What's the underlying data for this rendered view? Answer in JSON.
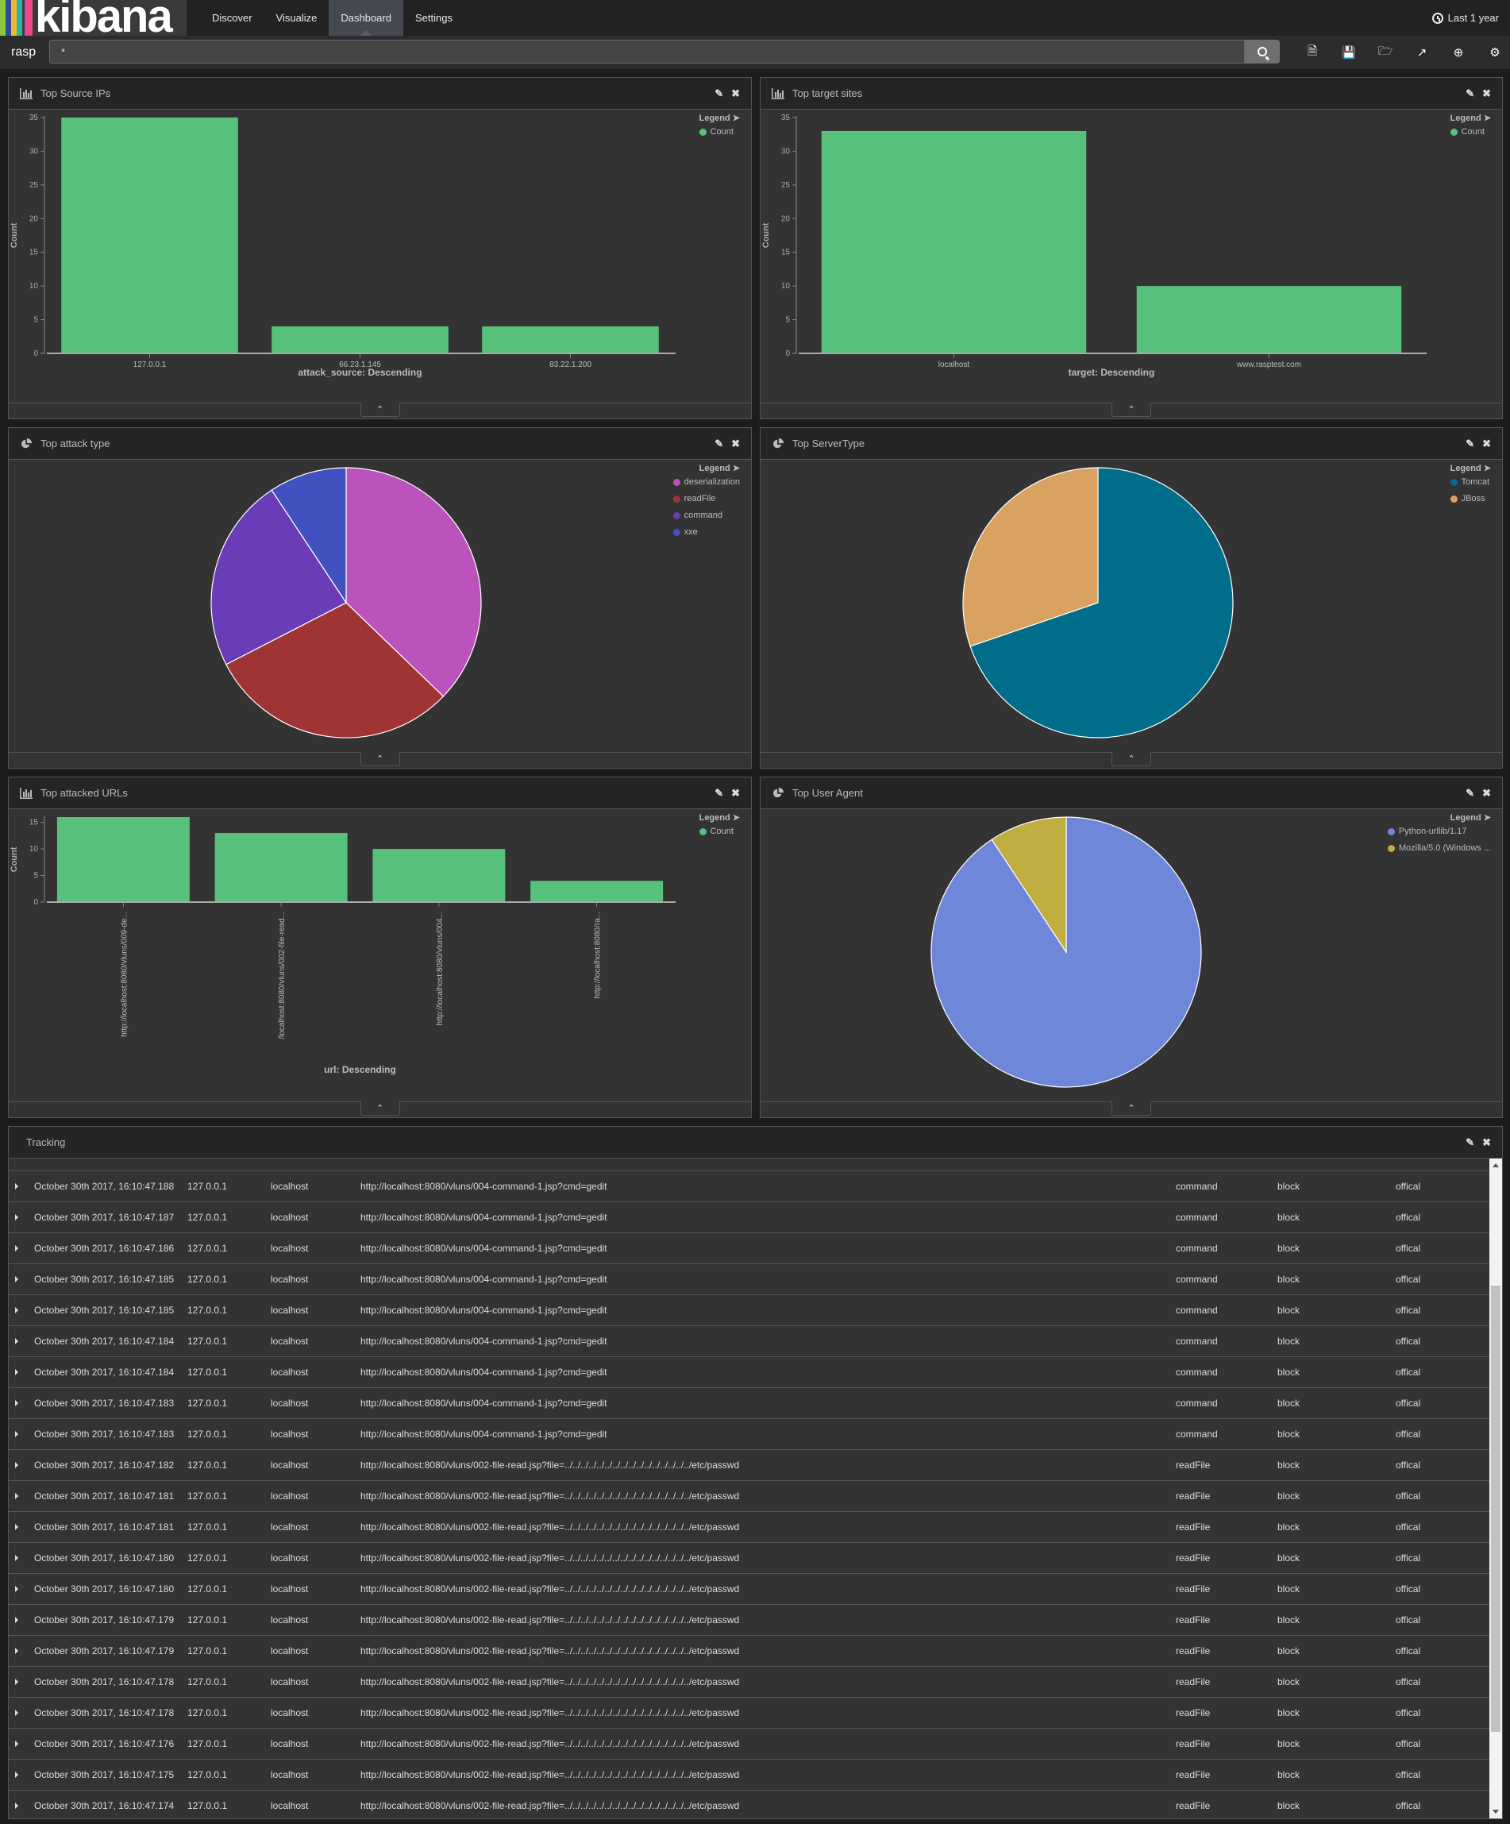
{
  "app": {
    "logo_text": "kibana",
    "logo_colors": [
      "#8cc63f",
      "#2b4b9b",
      "#f5b72d",
      "#1fb8a9",
      "#e8478b"
    ],
    "nav": [
      {
        "label": "Discover",
        "active": false
      },
      {
        "label": "Visualize",
        "active": false
      },
      {
        "label": "Dashboard",
        "active": true
      },
      {
        "label": "Settings",
        "active": false
      }
    ],
    "time_range": "Last 1 year"
  },
  "query": {
    "index": "rasp",
    "value": "*",
    "toolbar_icons": [
      "new-dashboard-icon",
      "save-icon",
      "open-folder-icon",
      "share-icon",
      "add-panel-icon",
      "gear-icon"
    ]
  },
  "panels": {
    "source_ips": {
      "title": "Top Source IPs",
      "legend_title": "Legend",
      "x_label": "attack_source: Descending",
      "y_label": "Count"
    },
    "target_sites": {
      "title": "Top target sites",
      "legend_title": "Legend",
      "x_label": "target: Descending",
      "y_label": "Count"
    },
    "attack_type": {
      "title": "Top attack type",
      "legend_title": "Legend"
    },
    "server_type": {
      "title": "Top ServerType",
      "legend_title": "Legend"
    },
    "attacked_urls": {
      "title": "Top attacked URLs",
      "legend_title": "Legend",
      "x_label": "url: Descending",
      "y_label": "Count"
    },
    "user_agent": {
      "title": "Top User Agent",
      "legend_title": "Legend"
    },
    "tracking": {
      "title": "Tracking"
    }
  },
  "chart_data": [
    {
      "id": "source_ips",
      "type": "bar",
      "title": "Top Source IPs",
      "categories": [
        "127.0.0.1",
        "66.23.1.145",
        "83.22.1.200"
      ],
      "values": [
        35,
        4,
        4
      ],
      "xlabel": "attack_source: Descending",
      "ylabel": "Count",
      "ylim": [
        0,
        35
      ],
      "yticks": [
        0,
        5,
        10,
        15,
        20,
        25,
        30,
        35
      ],
      "legend": [
        {
          "name": "Count",
          "color": "#57c17b"
        }
      ],
      "legend_position": "top-right",
      "grid": false
    },
    {
      "id": "target_sites",
      "type": "bar",
      "title": "Top target sites",
      "categories": [
        "localhost",
        "www.rasptest.com"
      ],
      "values": [
        33,
        10
      ],
      "xlabel": "target: Descending",
      "ylabel": "Count",
      "ylim": [
        0,
        35
      ],
      "yticks": [
        0,
        5,
        10,
        15,
        20,
        25,
        30,
        35
      ],
      "legend": [
        {
          "name": "Count",
          "color": "#57c17b"
        }
      ],
      "legend_position": "top-right",
      "grid": false
    },
    {
      "id": "attack_type",
      "type": "pie",
      "title": "Top attack type",
      "categories": [
        "deserialization",
        "readFile",
        "command",
        "xxe"
      ],
      "values": [
        16,
        13,
        10,
        4
      ],
      "colors": [
        "#ba53bb",
        "#a03434",
        "#6a3cb8",
        "#4151c0"
      ],
      "legend_position": "top-right"
    },
    {
      "id": "server_type",
      "type": "pie",
      "title": "Top ServerType",
      "categories": [
        "Tomcat",
        "JBoss"
      ],
      "values": [
        30,
        13
      ],
      "colors": [
        "#006e8a",
        "#d9a261"
      ],
      "legend_position": "top-right"
    },
    {
      "id": "attacked_urls",
      "type": "bar",
      "title": "Top attacked URLs",
      "categories": [
        "http://localhost:8080/vluns/009-de...",
        "/localhost:8080/vluns/002-file-read...",
        "http://localhost:8080/vluns/004...",
        "http://localhost:8080/ra..."
      ],
      "values": [
        16,
        13,
        10,
        4
      ],
      "xlabel": "url: Descending",
      "ylabel": "Count",
      "ylim": [
        0,
        16
      ],
      "yticks": [
        0,
        5,
        10,
        15
      ],
      "legend": [
        {
          "name": "Count",
          "color": "#57c17b"
        }
      ],
      "legend_position": "top-right",
      "grid": false
    },
    {
      "id": "user_agent",
      "type": "pie",
      "title": "Top User Agent",
      "categories": [
        "Python-urllib/1.17",
        "Mozilla/5.0 (Windows ..."
      ],
      "values": [
        39,
        4
      ],
      "colors": [
        "#6f87d8",
        "#c0ae41"
      ],
      "legend_position": "top-right"
    }
  ],
  "tracking": {
    "rows": [
      [
        "October 30th 2017, 16:10:47.188",
        "127.0.0.1",
        "localhost",
        "http://localhost:8080/vluns/004-command-1.jsp?cmd=gedit",
        "command",
        "block",
        "offical"
      ],
      [
        "October 30th 2017, 16:10:47.187",
        "127.0.0.1",
        "localhost",
        "http://localhost:8080/vluns/004-command-1.jsp?cmd=gedit",
        "command",
        "block",
        "offical"
      ],
      [
        "October 30th 2017, 16:10:47.186",
        "127.0.0.1",
        "localhost",
        "http://localhost:8080/vluns/004-command-1.jsp?cmd=gedit",
        "command",
        "block",
        "offical"
      ],
      [
        "October 30th 2017, 16:10:47.185",
        "127.0.0.1",
        "localhost",
        "http://localhost:8080/vluns/004-command-1.jsp?cmd=gedit",
        "command",
        "block",
        "offical"
      ],
      [
        "October 30th 2017, 16:10:47.185",
        "127.0.0.1",
        "localhost",
        "http://localhost:8080/vluns/004-command-1.jsp?cmd=gedit",
        "command",
        "block",
        "offical"
      ],
      [
        "October 30th 2017, 16:10:47.184",
        "127.0.0.1",
        "localhost",
        "http://localhost:8080/vluns/004-command-1.jsp?cmd=gedit",
        "command",
        "block",
        "offical"
      ],
      [
        "October 30th 2017, 16:10:47.184",
        "127.0.0.1",
        "localhost",
        "http://localhost:8080/vluns/004-command-1.jsp?cmd=gedit",
        "command",
        "block",
        "offical"
      ],
      [
        "October 30th 2017, 16:10:47.183",
        "127.0.0.1",
        "localhost",
        "http://localhost:8080/vluns/004-command-1.jsp?cmd=gedit",
        "command",
        "block",
        "offical"
      ],
      [
        "October 30th 2017, 16:10:47.183",
        "127.0.0.1",
        "localhost",
        "http://localhost:8080/vluns/004-command-1.jsp?cmd=gedit",
        "command",
        "block",
        "offical"
      ],
      [
        "October 30th 2017, 16:10:47.182",
        "127.0.0.1",
        "localhost",
        "http://localhost:8080/vluns/002-file-read.jsp?file=../../../../../../../../../../../../../../../../etc/passwd",
        "readFile",
        "block",
        "offical"
      ],
      [
        "October 30th 2017, 16:10:47.181",
        "127.0.0.1",
        "localhost",
        "http://localhost:8080/vluns/002-file-read.jsp?file=../../../../../../../../../../../../../../../../etc/passwd",
        "readFile",
        "block",
        "offical"
      ],
      [
        "October 30th 2017, 16:10:47.181",
        "127.0.0.1",
        "localhost",
        "http://localhost:8080/vluns/002-file-read.jsp?file=../../../../../../../../../../../../../../../../etc/passwd",
        "readFile",
        "block",
        "offical"
      ],
      [
        "October 30th 2017, 16:10:47.180",
        "127.0.0.1",
        "localhost",
        "http://localhost:8080/vluns/002-file-read.jsp?file=../../../../../../../../../../../../../../../../etc/passwd",
        "readFile",
        "block",
        "offical"
      ],
      [
        "October 30th 2017, 16:10:47.180",
        "127.0.0.1",
        "localhost",
        "http://localhost:8080/vluns/002-file-read.jsp?file=../../../../../../../../../../../../../../../../etc/passwd",
        "readFile",
        "block",
        "offical"
      ],
      [
        "October 30th 2017, 16:10:47.179",
        "127.0.0.1",
        "localhost",
        "http://localhost:8080/vluns/002-file-read.jsp?file=../../../../../../../../../../../../../../../../etc/passwd",
        "readFile",
        "block",
        "offical"
      ],
      [
        "October 30th 2017, 16:10:47.179",
        "127.0.0.1",
        "localhost",
        "http://localhost:8080/vluns/002-file-read.jsp?file=../../../../../../../../../../../../../../../../etc/passwd",
        "readFile",
        "block",
        "offical"
      ],
      [
        "October 30th 2017, 16:10:47.178",
        "127.0.0.1",
        "localhost",
        "http://localhost:8080/vluns/002-file-read.jsp?file=../../../../../../../../../../../../../../../../etc/passwd",
        "readFile",
        "block",
        "offical"
      ],
      [
        "October 30th 2017, 16:10:47.178",
        "127.0.0.1",
        "localhost",
        "http://localhost:8080/vluns/002-file-read.jsp?file=../../../../../../../../../../../../../../../../etc/passwd",
        "readFile",
        "block",
        "offical"
      ],
      [
        "October 30th 2017, 16:10:47.176",
        "127.0.0.1",
        "localhost",
        "http://localhost:8080/vluns/002-file-read.jsp?file=../../../../../../../../../../../../../../../../etc/passwd",
        "readFile",
        "block",
        "offical"
      ],
      [
        "October 30th 2017, 16:10:47.175",
        "127.0.0.1",
        "localhost",
        "http://localhost:8080/vluns/002-file-read.jsp?file=../../../../../../../../../../../../../../../../etc/passwd",
        "readFile",
        "block",
        "offical"
      ],
      [
        "October 30th 2017, 16:10:47.174",
        "127.0.0.1",
        "localhost",
        "http://localhost:8080/vluns/002-file-read.jsp?file=../../../../../../../../../../../../../../../../etc/passwd",
        "readFile",
        "block",
        "offical"
      ]
    ],
    "scroll_position": 0.6
  }
}
